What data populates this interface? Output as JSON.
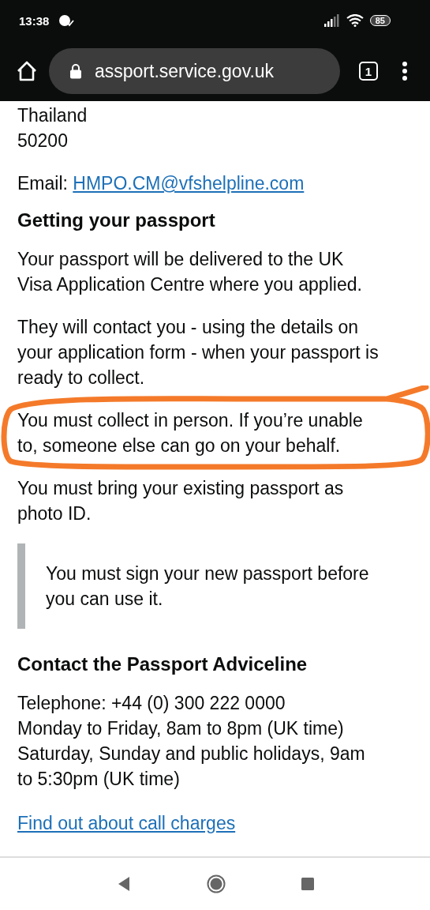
{
  "status_bar": {
    "time": "13:38",
    "battery": "85"
  },
  "browser": {
    "url": "assport.service.gov.uk",
    "tab_count": "1"
  },
  "address": [
    {
      "text": "Thailand"
    },
    {
      "text": "50200"
    }
  ],
  "email": {
    "label": "Email:",
    "link": "HMPO.CM@vfshelpline.com"
  },
  "sections": [
    {
      "heading": "Getting your passport",
      "blocks": [
        {
          "kind": "paragraph",
          "text": "Your passport will be delivered to the UK Visa Application Centre where you applied."
        },
        {
          "kind": "paragraph",
          "text": "They will contact you - using the details on your application form - when your passport is ready to collect."
        },
        {
          "kind": "paragraph",
          "circled": true,
          "text": "You must collect in person. If you’re unable to, someone else can go on your behalf."
        },
        {
          "kind": "paragraph",
          "text": "You must bring your existing passport as photo ID."
        },
        {
          "kind": "inset",
          "text": "You must sign your new passport before you can use it."
        }
      ]
    },
    {
      "heading": "Contact the Passport Adviceline",
      "blocks": [
        {
          "kind": "lines",
          "lines": [
            "Telephone: +44 (0) 300 222 0000",
            "Monday to Friday, 8am to 8pm (UK time)",
            "Saturday, Sunday and public holidays, 9am to 5:30pm (UK time)"
          ]
        },
        {
          "kind": "link",
          "text": "Find out about call charges"
        }
      ]
    }
  ]
}
